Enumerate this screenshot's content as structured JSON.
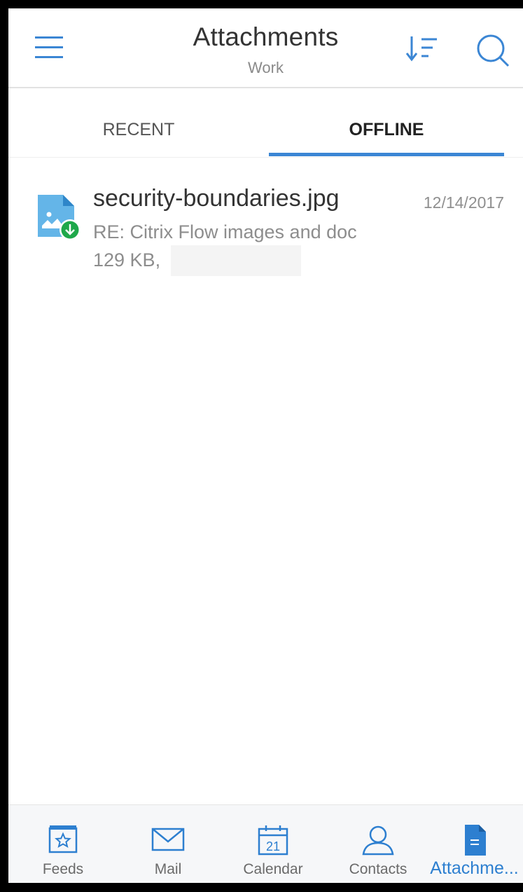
{
  "header": {
    "title": "Attachments",
    "subtitle": "Work",
    "icons": {
      "menu": "menu-icon",
      "sort": "sort-icon",
      "search": "search-icon"
    }
  },
  "tabs": [
    {
      "label": "RECENT",
      "active": false
    },
    {
      "label": "OFFLINE",
      "active": true
    }
  ],
  "attachments": [
    {
      "name": "security-boundaries.jpg",
      "date": "12/14/2017",
      "subject": "RE: Citrix Flow images and doc",
      "meta": "129 KB,",
      "icon": "image-file-downloaded-icon"
    }
  ],
  "bottom_nav": [
    {
      "label": "Feeds",
      "icon": "feeds-icon",
      "active": false
    },
    {
      "label": "Mail",
      "icon": "mail-icon",
      "active": false
    },
    {
      "label": "Calendar",
      "icon": "calendar-icon",
      "calendar_day": "21",
      "active": false
    },
    {
      "label": "Contacts",
      "icon": "contacts-icon",
      "active": false
    },
    {
      "label": "Attachme...",
      "icon": "attachments-icon",
      "active": true
    }
  ],
  "colors": {
    "accent": "#3b86d4",
    "icon_blue": "#2d7fd0",
    "download_badge": "#1fa84a",
    "file_icon": "#64b5e8"
  }
}
